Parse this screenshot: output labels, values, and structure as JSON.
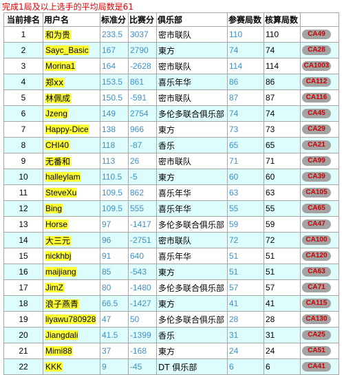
{
  "summary": "完成1局及以上选手的平均局数是61",
  "headers": {
    "rank": "当前排名",
    "username": "用户名",
    "standard": "标准分",
    "match": "比赛分",
    "club": "俱乐部",
    "played": "参赛局数",
    "counted": "核算局数"
  },
  "rows": [
    {
      "rank": "1",
      "username": "和为贵",
      "standard": "233.5",
      "match": "3037",
      "club": "密市联队",
      "played": "110",
      "counted": "110",
      "badge": "CA49"
    },
    {
      "rank": "2",
      "username": "Sayc_Basic",
      "standard": "167",
      "match": "2790",
      "club": "東方",
      "played": "74",
      "counted": "74",
      "badge": "CA28"
    },
    {
      "rank": "3",
      "username": "Morina1",
      "standard": "164",
      "match": "-2628",
      "club": "密市联队",
      "played": "114",
      "counted": "114",
      "badge": "CA1003"
    },
    {
      "rank": "4",
      "username": "郑xx",
      "standard": "153.5",
      "match": "861",
      "club": "喜乐年华",
      "played": "86",
      "counted": "86",
      "badge": "CA112"
    },
    {
      "rank": "5",
      "username": "林佩成",
      "standard": "150.5",
      "match": "-591",
      "club": "密市联队",
      "played": "87",
      "counted": "87",
      "badge": "CA116"
    },
    {
      "rank": "6",
      "username": "Jzeng",
      "standard": "149",
      "match": "2754",
      "club": "多伦多联合俱乐部",
      "played": "74",
      "counted": "74",
      "badge": "CA45"
    },
    {
      "rank": "7",
      "username": "Happy-Dice",
      "standard": "138",
      "match": "966",
      "club": "東方",
      "played": "73",
      "counted": "73",
      "badge": "CA29"
    },
    {
      "rank": "8",
      "username": "CHI40",
      "standard": "118",
      "match": "-87",
      "club": "香乐",
      "played": "65",
      "counted": "65",
      "badge": "CA21"
    },
    {
      "rank": "9",
      "username": "无番和",
      "standard": "113",
      "match": "26",
      "club": "密市联队",
      "played": "71",
      "counted": "71",
      "badge": "CA99"
    },
    {
      "rank": "10",
      "username": "halleylam",
      "standard": "110.5",
      "match": "-5",
      "club": "東方",
      "played": "60",
      "counted": "60",
      "badge": "CA39"
    },
    {
      "rank": "11",
      "username": "SteveXu",
      "standard": "109.5",
      "match": "862",
      "club": "喜乐年华",
      "played": "63",
      "counted": "63",
      "badge": "CA105"
    },
    {
      "rank": "12",
      "username": "Bing",
      "standard": "109.5",
      "match": "555",
      "club": "喜乐年华",
      "played": "55",
      "counted": "55",
      "badge": "CA65"
    },
    {
      "rank": "13",
      "username": "Horse",
      "standard": "97",
      "match": "-1417",
      "club": "多伦多联合俱乐部",
      "played": "59",
      "counted": "59",
      "badge": "CA47"
    },
    {
      "rank": "14",
      "username": "大三元",
      "standard": "96",
      "match": "-2751",
      "club": "密市联队",
      "played": "72",
      "counted": "72",
      "badge": "CA100"
    },
    {
      "rank": "15",
      "username": "nickhbj",
      "standard": "91",
      "match": "640",
      "club": "喜乐年华",
      "played": "51",
      "counted": "51",
      "badge": "CA120"
    },
    {
      "rank": "16",
      "username": "maijiang",
      "standard": "85",
      "match": "-543",
      "club": "東方",
      "played": "51",
      "counted": "51",
      "badge": "CA63"
    },
    {
      "rank": "17",
      "username": "JimZ",
      "standard": "80",
      "match": "-1480",
      "club": "多伦多联合俱乐部",
      "played": "57",
      "counted": "57",
      "badge": "CA71"
    },
    {
      "rank": "18",
      "username": "浪子燕青",
      "standard": "66.5",
      "match": "-1427",
      "club": "東方",
      "played": "41",
      "counted": "41",
      "badge": "CA115"
    },
    {
      "rank": "19",
      "username": "liyawu780928",
      "standard": "47",
      "match": "50",
      "club": "多伦多联合俱乐部",
      "played": "28",
      "counted": "28",
      "badge": "CA130"
    },
    {
      "rank": "20",
      "username": "Jiangdali",
      "standard": "41.5",
      "match": "-1399",
      "club": "香乐",
      "played": "31",
      "counted": "31",
      "badge": "CA25"
    },
    {
      "rank": "21",
      "username": "Mimi88",
      "standard": "37",
      "match": "-168",
      "club": "東方",
      "played": "24",
      "counted": "24",
      "badge": "CA51"
    },
    {
      "rank": "22",
      "username": "KKK",
      "standard": "9",
      "match": "-45",
      "club": "DT 俱乐部",
      "played": "6",
      "counted": "6",
      "badge": "CA41"
    }
  ],
  "colors": {
    "summary_text": "#dd0000",
    "alt_row_bg": "#ddfcfc",
    "username_highlight": "#ffff33",
    "number_blue": "#3f8fc8",
    "badge_bg": "#a3a3a3",
    "badge_text": "#cc0000",
    "border": "#a6a6a6"
  }
}
